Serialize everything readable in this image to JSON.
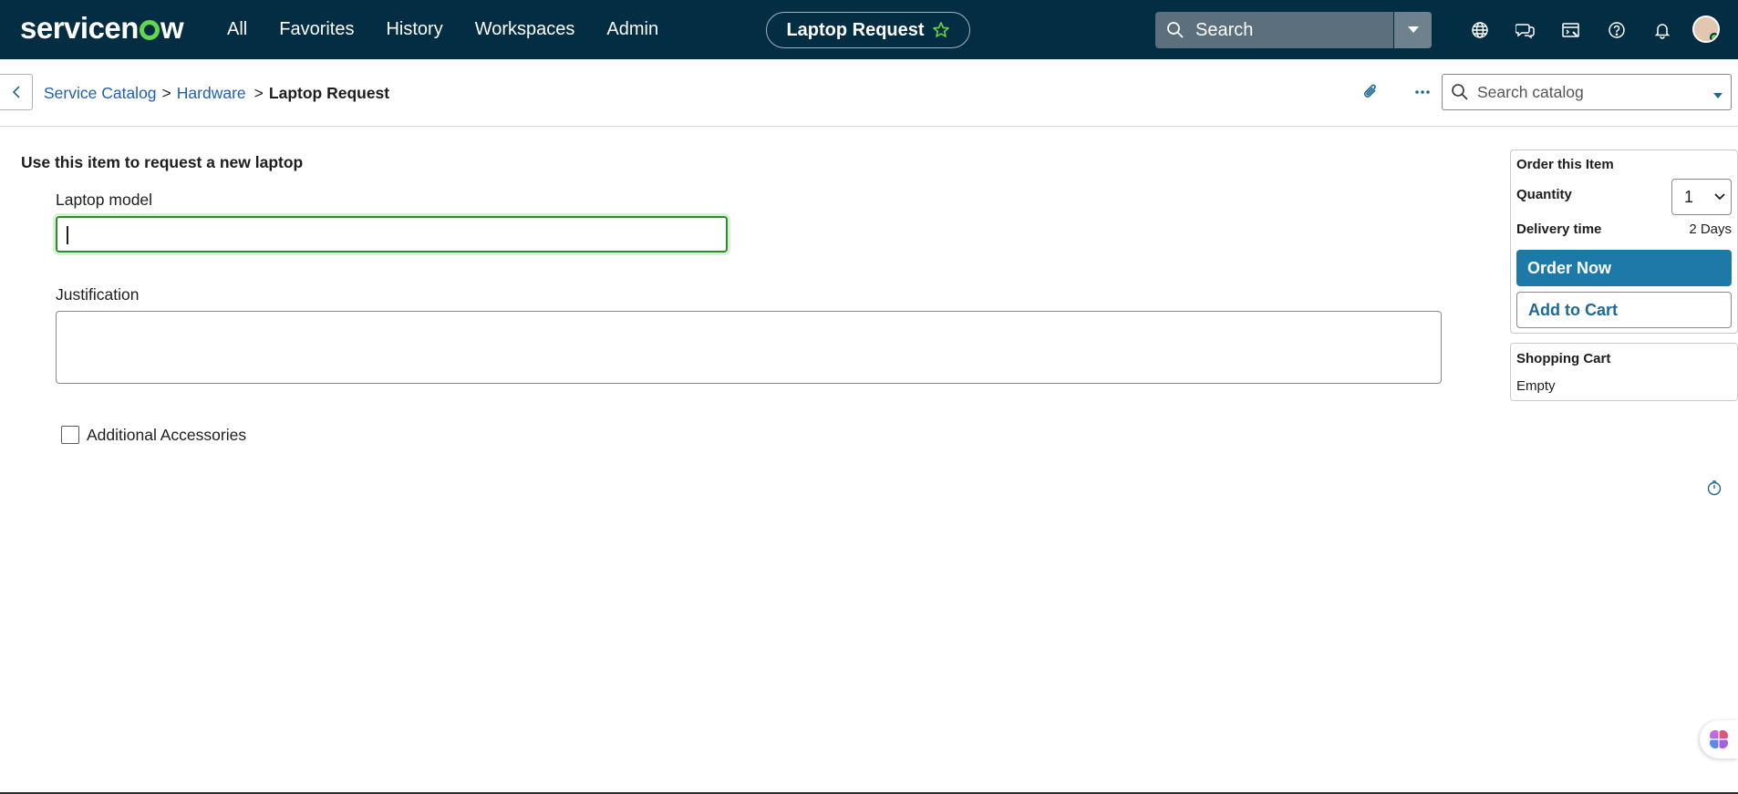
{
  "nav": {
    "logo": "servicenow",
    "links": [
      "All",
      "Favorites",
      "History",
      "Workspaces",
      "Admin"
    ],
    "context_pill": "Laptop Request",
    "search_placeholder": "Search",
    "icons": [
      "globe-icon",
      "chat-icon",
      "scripts-icon",
      "help-icon",
      "bell-icon"
    ]
  },
  "header": {
    "breadcrumbs": [
      "Service Catalog",
      "Hardware",
      "Laptop Request"
    ],
    "catalog_search_placeholder": "Search catalog"
  },
  "form": {
    "description": "Use this item to request a new laptop",
    "laptop_model_label": "Laptop model",
    "laptop_model_value": "",
    "justification_label": "Justification",
    "justification_value": "",
    "accessories_label": "Additional Accessories",
    "accessories_checked": false
  },
  "order": {
    "title": "Order this Item",
    "quantity_label": "Quantity",
    "quantity_value": "1",
    "delivery_label": "Delivery time",
    "delivery_value": "2 Days",
    "order_now": "Order Now",
    "add_to_cart": "Add to Cart"
  },
  "cart": {
    "title": "Shopping Cart",
    "status": "Empty"
  },
  "colors": {
    "nav_bg": "#032d42",
    "brand_green": "#62d84e",
    "primary_button": "#1d7aa8",
    "link": "#1f5fb0"
  }
}
